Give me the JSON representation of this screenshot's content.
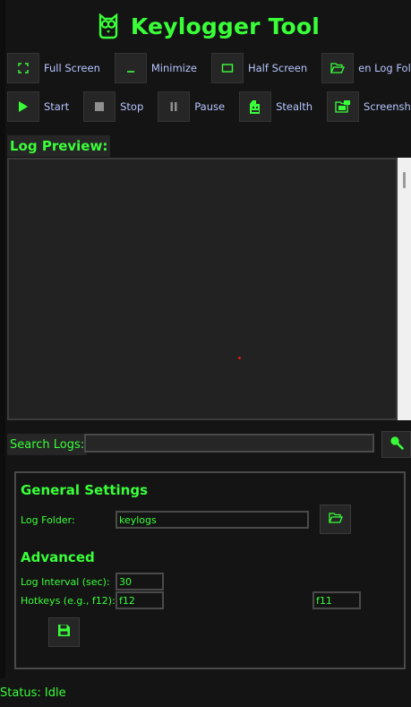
{
  "app": {
    "title": "Keylogger Tool",
    "logo_icon": "owl-icon"
  },
  "colors": {
    "accent": "#39ff39",
    "label": "#b7c6ff",
    "panel": "#141414",
    "button": "#262626"
  },
  "window_buttons": [
    {
      "label": "Full Screen",
      "icon": "fullscreen-icon"
    },
    {
      "label": "Minimize",
      "icon": "minimize-icon"
    },
    {
      "label": "Half Screen",
      "icon": "half-screen-icon"
    },
    {
      "label": "en Log Fol",
      "icon": "folder-open-icon"
    }
  ],
  "control_buttons": [
    {
      "label": "Start",
      "icon": "play-icon"
    },
    {
      "label": "Stop",
      "icon": "stop-icon"
    },
    {
      "label": "Pause",
      "icon": "pause-icon"
    },
    {
      "label": "Stealth",
      "icon": "stealth-icon"
    },
    {
      "label": "Screensho",
      "icon": "screenshot-icon"
    }
  ],
  "log_preview": {
    "label": "Log Preview:",
    "content": ""
  },
  "search": {
    "label": "Search Logs:",
    "value": "",
    "button_icon": "search-icon"
  },
  "general_settings": {
    "title": "General Settings",
    "log_folder_label": "Log Folder:",
    "log_folder_value": "keylogs",
    "browse_icon": "folder-icon"
  },
  "advanced": {
    "title": "Advanced",
    "interval_label": "Log Interval (sec):",
    "interval_value": "30",
    "hotkeys_label": "Hotkeys (e.g., f12):",
    "hotkey_1": "f12",
    "hotkey_2": "f11",
    "save_icon": "save-icon"
  },
  "status": {
    "text": "Status: Idle"
  }
}
